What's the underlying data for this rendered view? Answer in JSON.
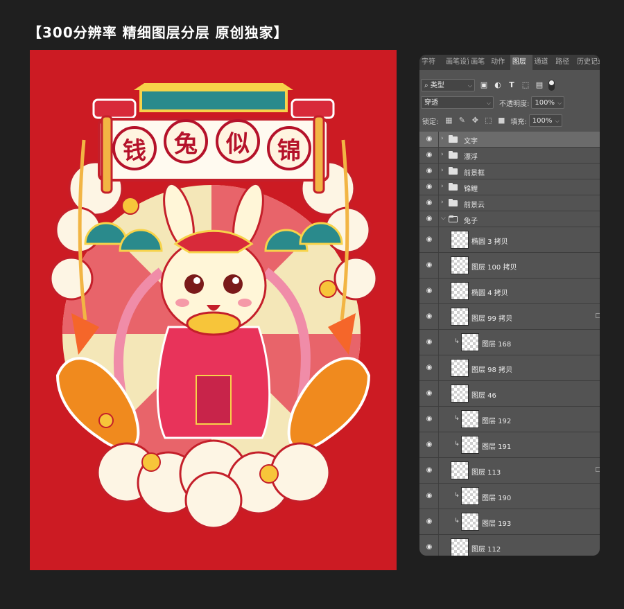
{
  "headline": "【300分辨率 精细图层分层 原创独家】",
  "artwork": {
    "title_chars": [
      "钱",
      "兔",
      "似",
      "锦"
    ]
  },
  "colors": {
    "page_bg": "#1f1f1f",
    "canvas_red": "#cc1b23",
    "panel_bg": "#535353",
    "panel_tabbar": "#3a3a3a",
    "selected_row": "#6b6b6b"
  },
  "panel": {
    "tabs": [
      {
        "label": "字符",
        "active": false
      },
      {
        "label": "画笔设置",
        "active": false
      },
      {
        "label": "画笔",
        "active": false
      },
      {
        "label": "动作",
        "active": false
      },
      {
        "label": "图层",
        "active": true
      },
      {
        "label": "通道",
        "active": false
      },
      {
        "label": "路径",
        "active": false
      },
      {
        "label": "历史记录",
        "active": false
      }
    ],
    "filter_label": "类型",
    "filter_icons": [
      "image-filter-icon",
      "adjustment-filter-icon",
      "text-filter-icon",
      "shape-filter-icon",
      "smartobject-filter-icon"
    ],
    "blend_mode": "穿透",
    "opacity_label": "不透明度:",
    "opacity_value": "100%",
    "lock_label": "锁定:",
    "fill_label": "填充:",
    "fill_value": "100%",
    "layers": [
      {
        "type": "group",
        "name": "文字",
        "expanded": false,
        "selected": true
      },
      {
        "type": "group",
        "name": "漂浮",
        "expanded": false
      },
      {
        "type": "group",
        "name": "前景框",
        "expanded": false
      },
      {
        "type": "group",
        "name": "锦鲤",
        "expanded": false
      },
      {
        "type": "group",
        "name": "前景云",
        "expanded": false
      },
      {
        "type": "group",
        "name": "兔子",
        "expanded": true
      },
      {
        "type": "layer",
        "name": "椭圆 3 拷贝",
        "clipped": false
      },
      {
        "type": "layer",
        "name": "图层 100 拷贝",
        "clipped": false
      },
      {
        "type": "layer",
        "name": "椭圆 4 拷贝",
        "clipped": false
      },
      {
        "type": "layer",
        "name": "图层 99 拷贝",
        "clipped": false,
        "locked": true
      },
      {
        "type": "layer",
        "name": "图层 168",
        "clipped": true
      },
      {
        "type": "layer",
        "name": "图层 98 拷贝",
        "clipped": false
      },
      {
        "type": "layer",
        "name": "图层 46",
        "clipped": false
      },
      {
        "type": "layer",
        "name": "图层 192",
        "clipped": true
      },
      {
        "type": "layer",
        "name": "图层 191",
        "clipped": true
      },
      {
        "type": "layer",
        "name": "图层 113",
        "clipped": false,
        "locked": true
      },
      {
        "type": "layer",
        "name": "图层 190",
        "clipped": true
      },
      {
        "type": "layer",
        "name": "图层 193",
        "clipped": true
      },
      {
        "type": "layer",
        "name": "图层 112",
        "clipped": false
      }
    ]
  }
}
